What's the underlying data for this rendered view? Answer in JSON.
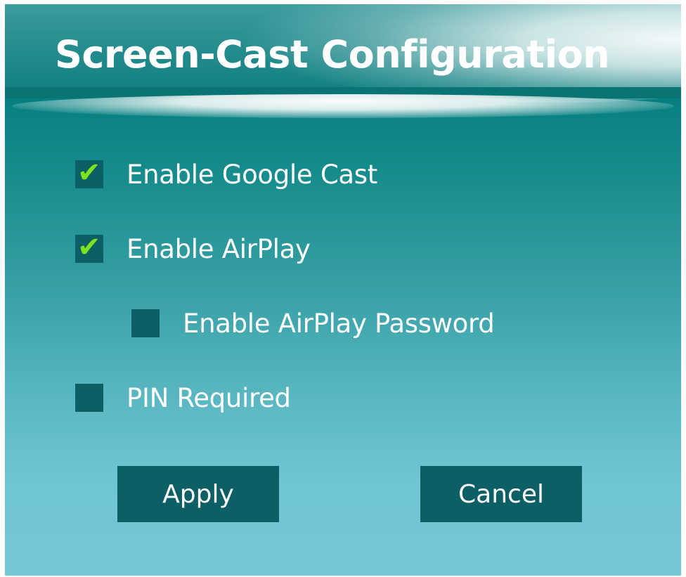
{
  "dialog": {
    "title": "Screen-Cast Configuration"
  },
  "options": [
    {
      "label": "Enable Google Cast",
      "checked": true
    },
    {
      "label": "Enable AirPlay",
      "checked": true
    },
    {
      "label": "Enable AirPlay Password",
      "checked": false
    },
    {
      "label": "PIN Required",
      "checked": false
    }
  ],
  "check_glyph": "✔",
  "buttons": {
    "apply": "Apply",
    "cancel": "Cancel"
  },
  "colors": {
    "checkbox_fill": "#0d5f66",
    "checkmark": "#7ee21f",
    "button_fill": "#0d5f66",
    "text": "#ffffff"
  }
}
